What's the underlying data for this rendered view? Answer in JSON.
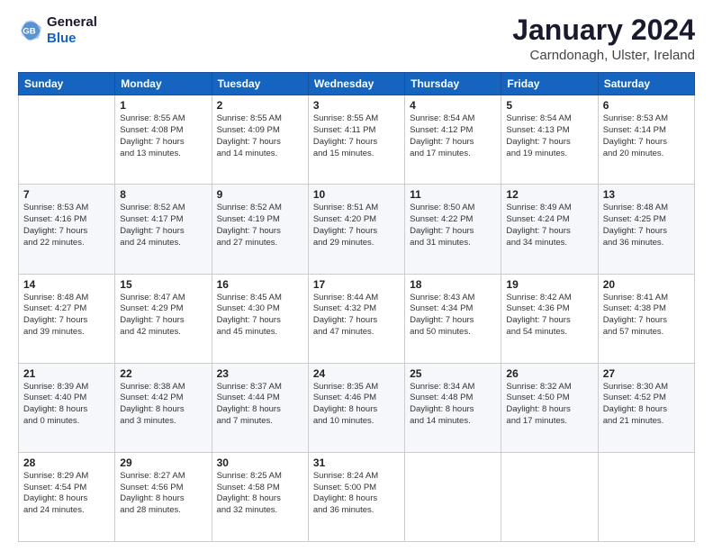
{
  "logo": {
    "line1": "General",
    "line2": "Blue"
  },
  "title": "January 2024",
  "location": "Carndonagh, Ulster, Ireland",
  "days_header": [
    "Sunday",
    "Monday",
    "Tuesday",
    "Wednesday",
    "Thursday",
    "Friday",
    "Saturday"
  ],
  "weeks": [
    [
      {
        "day": "",
        "lines": []
      },
      {
        "day": "1",
        "lines": [
          "Sunrise: 8:55 AM",
          "Sunset: 4:08 PM",
          "Daylight: 7 hours",
          "and 13 minutes."
        ]
      },
      {
        "day": "2",
        "lines": [
          "Sunrise: 8:55 AM",
          "Sunset: 4:09 PM",
          "Daylight: 7 hours",
          "and 14 minutes."
        ]
      },
      {
        "day": "3",
        "lines": [
          "Sunrise: 8:55 AM",
          "Sunset: 4:11 PM",
          "Daylight: 7 hours",
          "and 15 minutes."
        ]
      },
      {
        "day": "4",
        "lines": [
          "Sunrise: 8:54 AM",
          "Sunset: 4:12 PM",
          "Daylight: 7 hours",
          "and 17 minutes."
        ]
      },
      {
        "day": "5",
        "lines": [
          "Sunrise: 8:54 AM",
          "Sunset: 4:13 PM",
          "Daylight: 7 hours",
          "and 19 minutes."
        ]
      },
      {
        "day": "6",
        "lines": [
          "Sunrise: 8:53 AM",
          "Sunset: 4:14 PM",
          "Daylight: 7 hours",
          "and 20 minutes."
        ]
      }
    ],
    [
      {
        "day": "7",
        "lines": [
          "Sunrise: 8:53 AM",
          "Sunset: 4:16 PM",
          "Daylight: 7 hours",
          "and 22 minutes."
        ]
      },
      {
        "day": "8",
        "lines": [
          "Sunrise: 8:52 AM",
          "Sunset: 4:17 PM",
          "Daylight: 7 hours",
          "and 24 minutes."
        ]
      },
      {
        "day": "9",
        "lines": [
          "Sunrise: 8:52 AM",
          "Sunset: 4:19 PM",
          "Daylight: 7 hours",
          "and 27 minutes."
        ]
      },
      {
        "day": "10",
        "lines": [
          "Sunrise: 8:51 AM",
          "Sunset: 4:20 PM",
          "Daylight: 7 hours",
          "and 29 minutes."
        ]
      },
      {
        "day": "11",
        "lines": [
          "Sunrise: 8:50 AM",
          "Sunset: 4:22 PM",
          "Daylight: 7 hours",
          "and 31 minutes."
        ]
      },
      {
        "day": "12",
        "lines": [
          "Sunrise: 8:49 AM",
          "Sunset: 4:24 PM",
          "Daylight: 7 hours",
          "and 34 minutes."
        ]
      },
      {
        "day": "13",
        "lines": [
          "Sunrise: 8:48 AM",
          "Sunset: 4:25 PM",
          "Daylight: 7 hours",
          "and 36 minutes."
        ]
      }
    ],
    [
      {
        "day": "14",
        "lines": [
          "Sunrise: 8:48 AM",
          "Sunset: 4:27 PM",
          "Daylight: 7 hours",
          "and 39 minutes."
        ]
      },
      {
        "day": "15",
        "lines": [
          "Sunrise: 8:47 AM",
          "Sunset: 4:29 PM",
          "Daylight: 7 hours",
          "and 42 minutes."
        ]
      },
      {
        "day": "16",
        "lines": [
          "Sunrise: 8:45 AM",
          "Sunset: 4:30 PM",
          "Daylight: 7 hours",
          "and 45 minutes."
        ]
      },
      {
        "day": "17",
        "lines": [
          "Sunrise: 8:44 AM",
          "Sunset: 4:32 PM",
          "Daylight: 7 hours",
          "and 47 minutes."
        ]
      },
      {
        "day": "18",
        "lines": [
          "Sunrise: 8:43 AM",
          "Sunset: 4:34 PM",
          "Daylight: 7 hours",
          "and 50 minutes."
        ]
      },
      {
        "day": "19",
        "lines": [
          "Sunrise: 8:42 AM",
          "Sunset: 4:36 PM",
          "Daylight: 7 hours",
          "and 54 minutes."
        ]
      },
      {
        "day": "20",
        "lines": [
          "Sunrise: 8:41 AM",
          "Sunset: 4:38 PM",
          "Daylight: 7 hours",
          "and 57 minutes."
        ]
      }
    ],
    [
      {
        "day": "21",
        "lines": [
          "Sunrise: 8:39 AM",
          "Sunset: 4:40 PM",
          "Daylight: 8 hours",
          "and 0 minutes."
        ]
      },
      {
        "day": "22",
        "lines": [
          "Sunrise: 8:38 AM",
          "Sunset: 4:42 PM",
          "Daylight: 8 hours",
          "and 3 minutes."
        ]
      },
      {
        "day": "23",
        "lines": [
          "Sunrise: 8:37 AM",
          "Sunset: 4:44 PM",
          "Daylight: 8 hours",
          "and 7 minutes."
        ]
      },
      {
        "day": "24",
        "lines": [
          "Sunrise: 8:35 AM",
          "Sunset: 4:46 PM",
          "Daylight: 8 hours",
          "and 10 minutes."
        ]
      },
      {
        "day": "25",
        "lines": [
          "Sunrise: 8:34 AM",
          "Sunset: 4:48 PM",
          "Daylight: 8 hours",
          "and 14 minutes."
        ]
      },
      {
        "day": "26",
        "lines": [
          "Sunrise: 8:32 AM",
          "Sunset: 4:50 PM",
          "Daylight: 8 hours",
          "and 17 minutes."
        ]
      },
      {
        "day": "27",
        "lines": [
          "Sunrise: 8:30 AM",
          "Sunset: 4:52 PM",
          "Daylight: 8 hours",
          "and 21 minutes."
        ]
      }
    ],
    [
      {
        "day": "28",
        "lines": [
          "Sunrise: 8:29 AM",
          "Sunset: 4:54 PM",
          "Daylight: 8 hours",
          "and 24 minutes."
        ]
      },
      {
        "day": "29",
        "lines": [
          "Sunrise: 8:27 AM",
          "Sunset: 4:56 PM",
          "Daylight: 8 hours",
          "and 28 minutes."
        ]
      },
      {
        "day": "30",
        "lines": [
          "Sunrise: 8:25 AM",
          "Sunset: 4:58 PM",
          "Daylight: 8 hours",
          "and 32 minutes."
        ]
      },
      {
        "day": "31",
        "lines": [
          "Sunrise: 8:24 AM",
          "Sunset: 5:00 PM",
          "Daylight: 8 hours",
          "and 36 minutes."
        ]
      },
      {
        "day": "",
        "lines": []
      },
      {
        "day": "",
        "lines": []
      },
      {
        "day": "",
        "lines": []
      }
    ]
  ]
}
